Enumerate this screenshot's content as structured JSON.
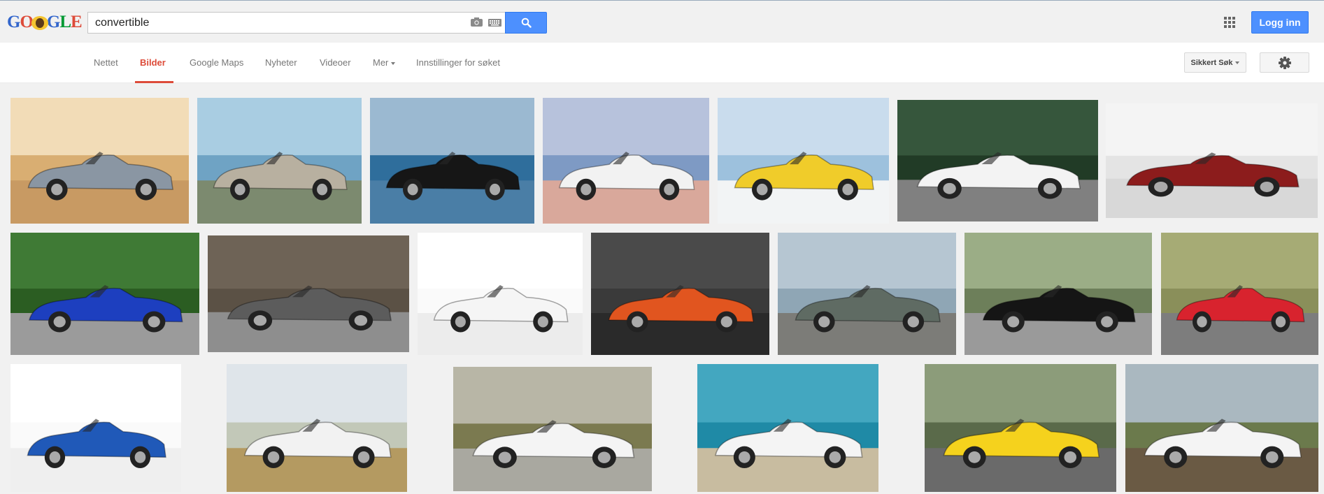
{
  "header": {
    "logo_text": "GOOGLE",
    "search_value": "convertible",
    "login_label": "Logg inn",
    "icons": [
      "camera-icon",
      "keyboard-icon",
      "search-icon",
      "apps-icon"
    ]
  },
  "nav": {
    "tabs": [
      {
        "label": "Nettet",
        "active": false
      },
      {
        "label": "Bilder",
        "active": true
      },
      {
        "label": "Google Maps",
        "active": false
      },
      {
        "label": "Nyheter",
        "active": false
      },
      {
        "label": "Videoer",
        "active": false
      },
      {
        "label": "Mer",
        "active": false
      },
      {
        "label": "Innstillinger for søket",
        "active": false
      }
    ],
    "safe_search_label": "Sikkert Søk",
    "settings_icon": "gear-icon"
  },
  "colors": {
    "accent": "#4d90fe",
    "active_tab": "#dd4b39",
    "results_bg": "#f1f1f1"
  },
  "results": {
    "images": [
      {
        "car": "silver coupe convertible",
        "bg": "#d9ae72",
        "sky": "#f2dcb7",
        "ground": "#c89a63",
        "car_color": "#8a96a3"
      },
      {
        "car": "silver convertible by sea",
        "bg": "#6fa3c4",
        "sky": "#a9cde2",
        "ground": "#7c8a6f",
        "car_color": "#b8b0a0"
      },
      {
        "car": "black beetle convertible",
        "bg": "#2f6e9c",
        "sky": "#9bb9d1",
        "ground": "#4a7ea6",
        "car_color": "#161616"
      },
      {
        "car": "white convertible on coast",
        "bg": "#7e9ac4",
        "sky": "#b7c2dc",
        "ground": "#d9a89b",
        "car_color": "#f2f2f2"
      },
      {
        "car": "yellow convertible with sunflowers",
        "bg": "#9dc1dd",
        "sky": "#c9dced",
        "ground": "#f2f4f5",
        "car_color": "#f0cc2a"
      },
      {
        "car": "white convertible dark trees",
        "bg": "#213b26",
        "sky": "#36563c",
        "ground": "#808080",
        "car_color": "#f3f3f3"
      },
      {
        "car": "red convertible studio",
        "bg": "#e4e4e4",
        "sky": "#f4f4f4",
        "ground": "#d8d8d8",
        "car_color": "#8c1c1c"
      },
      {
        "car": "blue roadster",
        "bg": "#2b5d22",
        "sky": "#3f7a35",
        "ground": "#9b9b9b",
        "car_color": "#1d3fbf"
      },
      {
        "car": "grey convertible wall",
        "bg": "#5b5145",
        "sky": "#6e6356",
        "ground": "#8e8e8e",
        "car_color": "#5c5c5c"
      },
      {
        "car": "white convertible studio",
        "bg": "#fafafa",
        "sky": "#ffffff",
        "ground": "#ececec",
        "car_color": "#f5f5f5"
      },
      {
        "car": "orange muscle convertible",
        "bg": "#3a3a3a",
        "sky": "#4a4a4a",
        "ground": "#2a2a2a",
        "car_color": "#e1551f"
      },
      {
        "car": "green muscle convertible",
        "bg": "#8fa6b5",
        "sky": "#b6c6d2",
        "ground": "#7c7c78",
        "car_color": "#5f6b63"
      },
      {
        "car": "black muscle convertible",
        "bg": "#6d7f5a",
        "sky": "#9bad86",
        "ground": "#9a9a9a",
        "car_color": "#151515"
      },
      {
        "car": "red convertible road",
        "bg": "#8a8f5a",
        "sky": "#a6ab75",
        "ground": "#7d7d7d",
        "car_color": "#d8232e"
      },
      {
        "car": "blue convertible studio",
        "bg": "#fafafa",
        "sky": "#ffffff",
        "ground": "#efefef",
        "car_color": "#2059b8"
      },
      {
        "car": "white sports convertible field",
        "bg": "#c2c8b8",
        "sky": "#dfe5ea",
        "ground": "#b49a61",
        "car_color": "#f2f2f2"
      },
      {
        "car": "white convertible hillside",
        "bg": "#7b7a50",
        "sky": "#b8b6a6",
        "ground": "#a9a8a0",
        "car_color": "#f4f4f4"
      },
      {
        "car": "white convertible by turquoise sea",
        "bg": "#1f8aa6",
        "sky": "#43a7c0",
        "ground": "#c8bca0",
        "car_color": "#f4f4f4"
      },
      {
        "car": "yellow sports convertible",
        "bg": "#5a6a4a",
        "sky": "#8c9c7a",
        "ground": "#6a6a6a",
        "car_color": "#f5d21d"
      },
      {
        "car": "white roadster coast",
        "bg": "#6b7a4c",
        "sky": "#aab8c0",
        "ground": "#6a5a44",
        "car_color": "#f4f4f4"
      }
    ]
  }
}
